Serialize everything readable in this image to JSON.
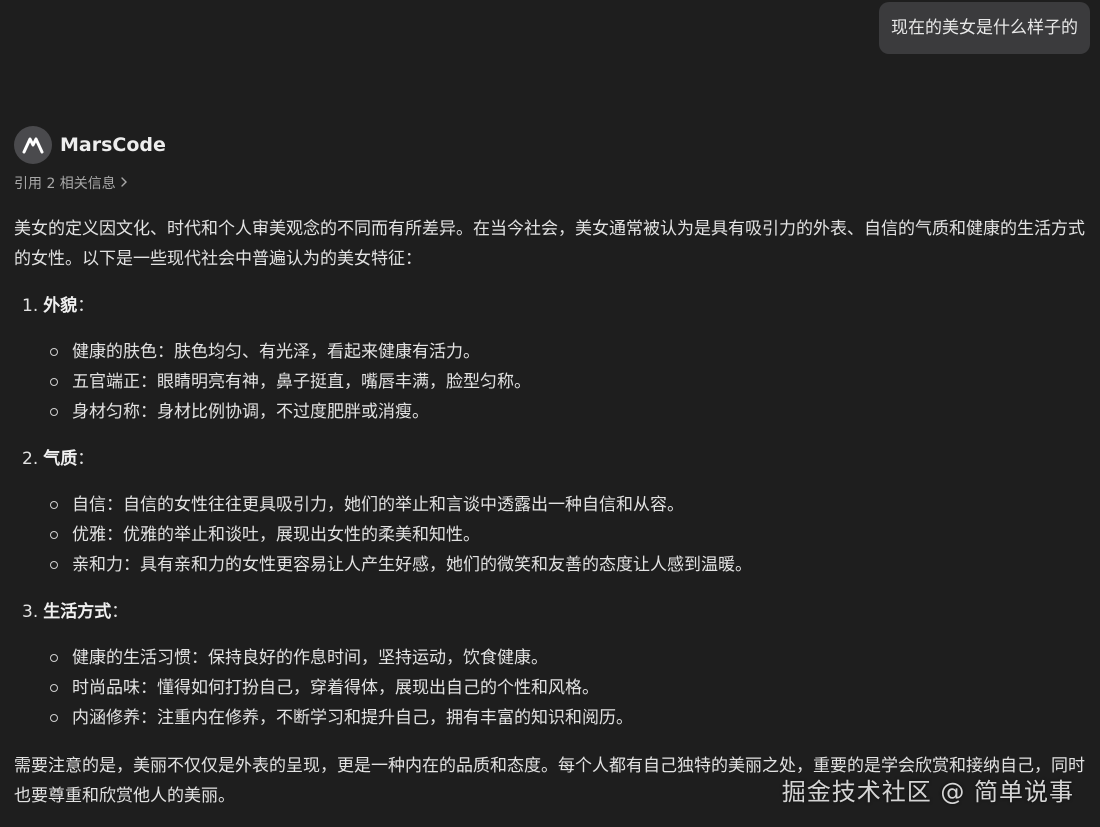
{
  "user_message": "现在的美女是什么样子的",
  "assistant": {
    "name": "MarsCode",
    "logo_icon": "marscode-logo-icon",
    "references_label": "引用 2 相关信息",
    "references_icon": "chevron-right-icon"
  },
  "answer": {
    "intro": "美女的定义因文化、时代和个人审美观念的不同而有所差异。在当今社会，美女通常被认为是具有吸引力的外表、自信的气质和健康的生活方式的女性。以下是一些现代社会中普遍认为的美女特征：",
    "sections": [
      {
        "number": "1.",
        "title": "外貌",
        "colon": "：",
        "items": [
          "健康的肤色：肤色均匀、有光泽，看起来健康有活力。",
          "五官端正：眼睛明亮有神，鼻子挺直，嘴唇丰满，脸型匀称。",
          "身材匀称：身材比例协调，不过度肥胖或消瘦。"
        ]
      },
      {
        "number": "2.",
        "title": "气质",
        "colon": "：",
        "items": [
          "自信：自信的女性往往更具吸引力，她们的举止和言谈中透露出一种自信和从容。",
          "优雅：优雅的举止和谈吐，展现出女性的柔美和知性。",
          "亲和力：具有亲和力的女性更容易让人产生好感，她们的微笑和友善的态度让人感到温暖。"
        ]
      },
      {
        "number": "3.",
        "title": "生活方式",
        "colon": "：",
        "items": [
          "健康的生活习惯：保持良好的作息时间，坚持运动，饮食健康。",
          "时尚品味：懂得如何打扮自己，穿着得体，展现出自己的个性和风格。",
          "内涵修养：注重内在修养，不断学习和提升自己，拥有丰富的知识和阅历。"
        ]
      }
    ],
    "closing": "需要注意的是，美丽不仅仅是外表的呈现，更是一种内在的品质和态度。每个人都有自己独特的美丽之处，重要的是学会欣赏和接纳自己，同时也要尊重和欣赏他人的美丽。"
  },
  "watermark": "掘金技术社区 @ 简单说事"
}
